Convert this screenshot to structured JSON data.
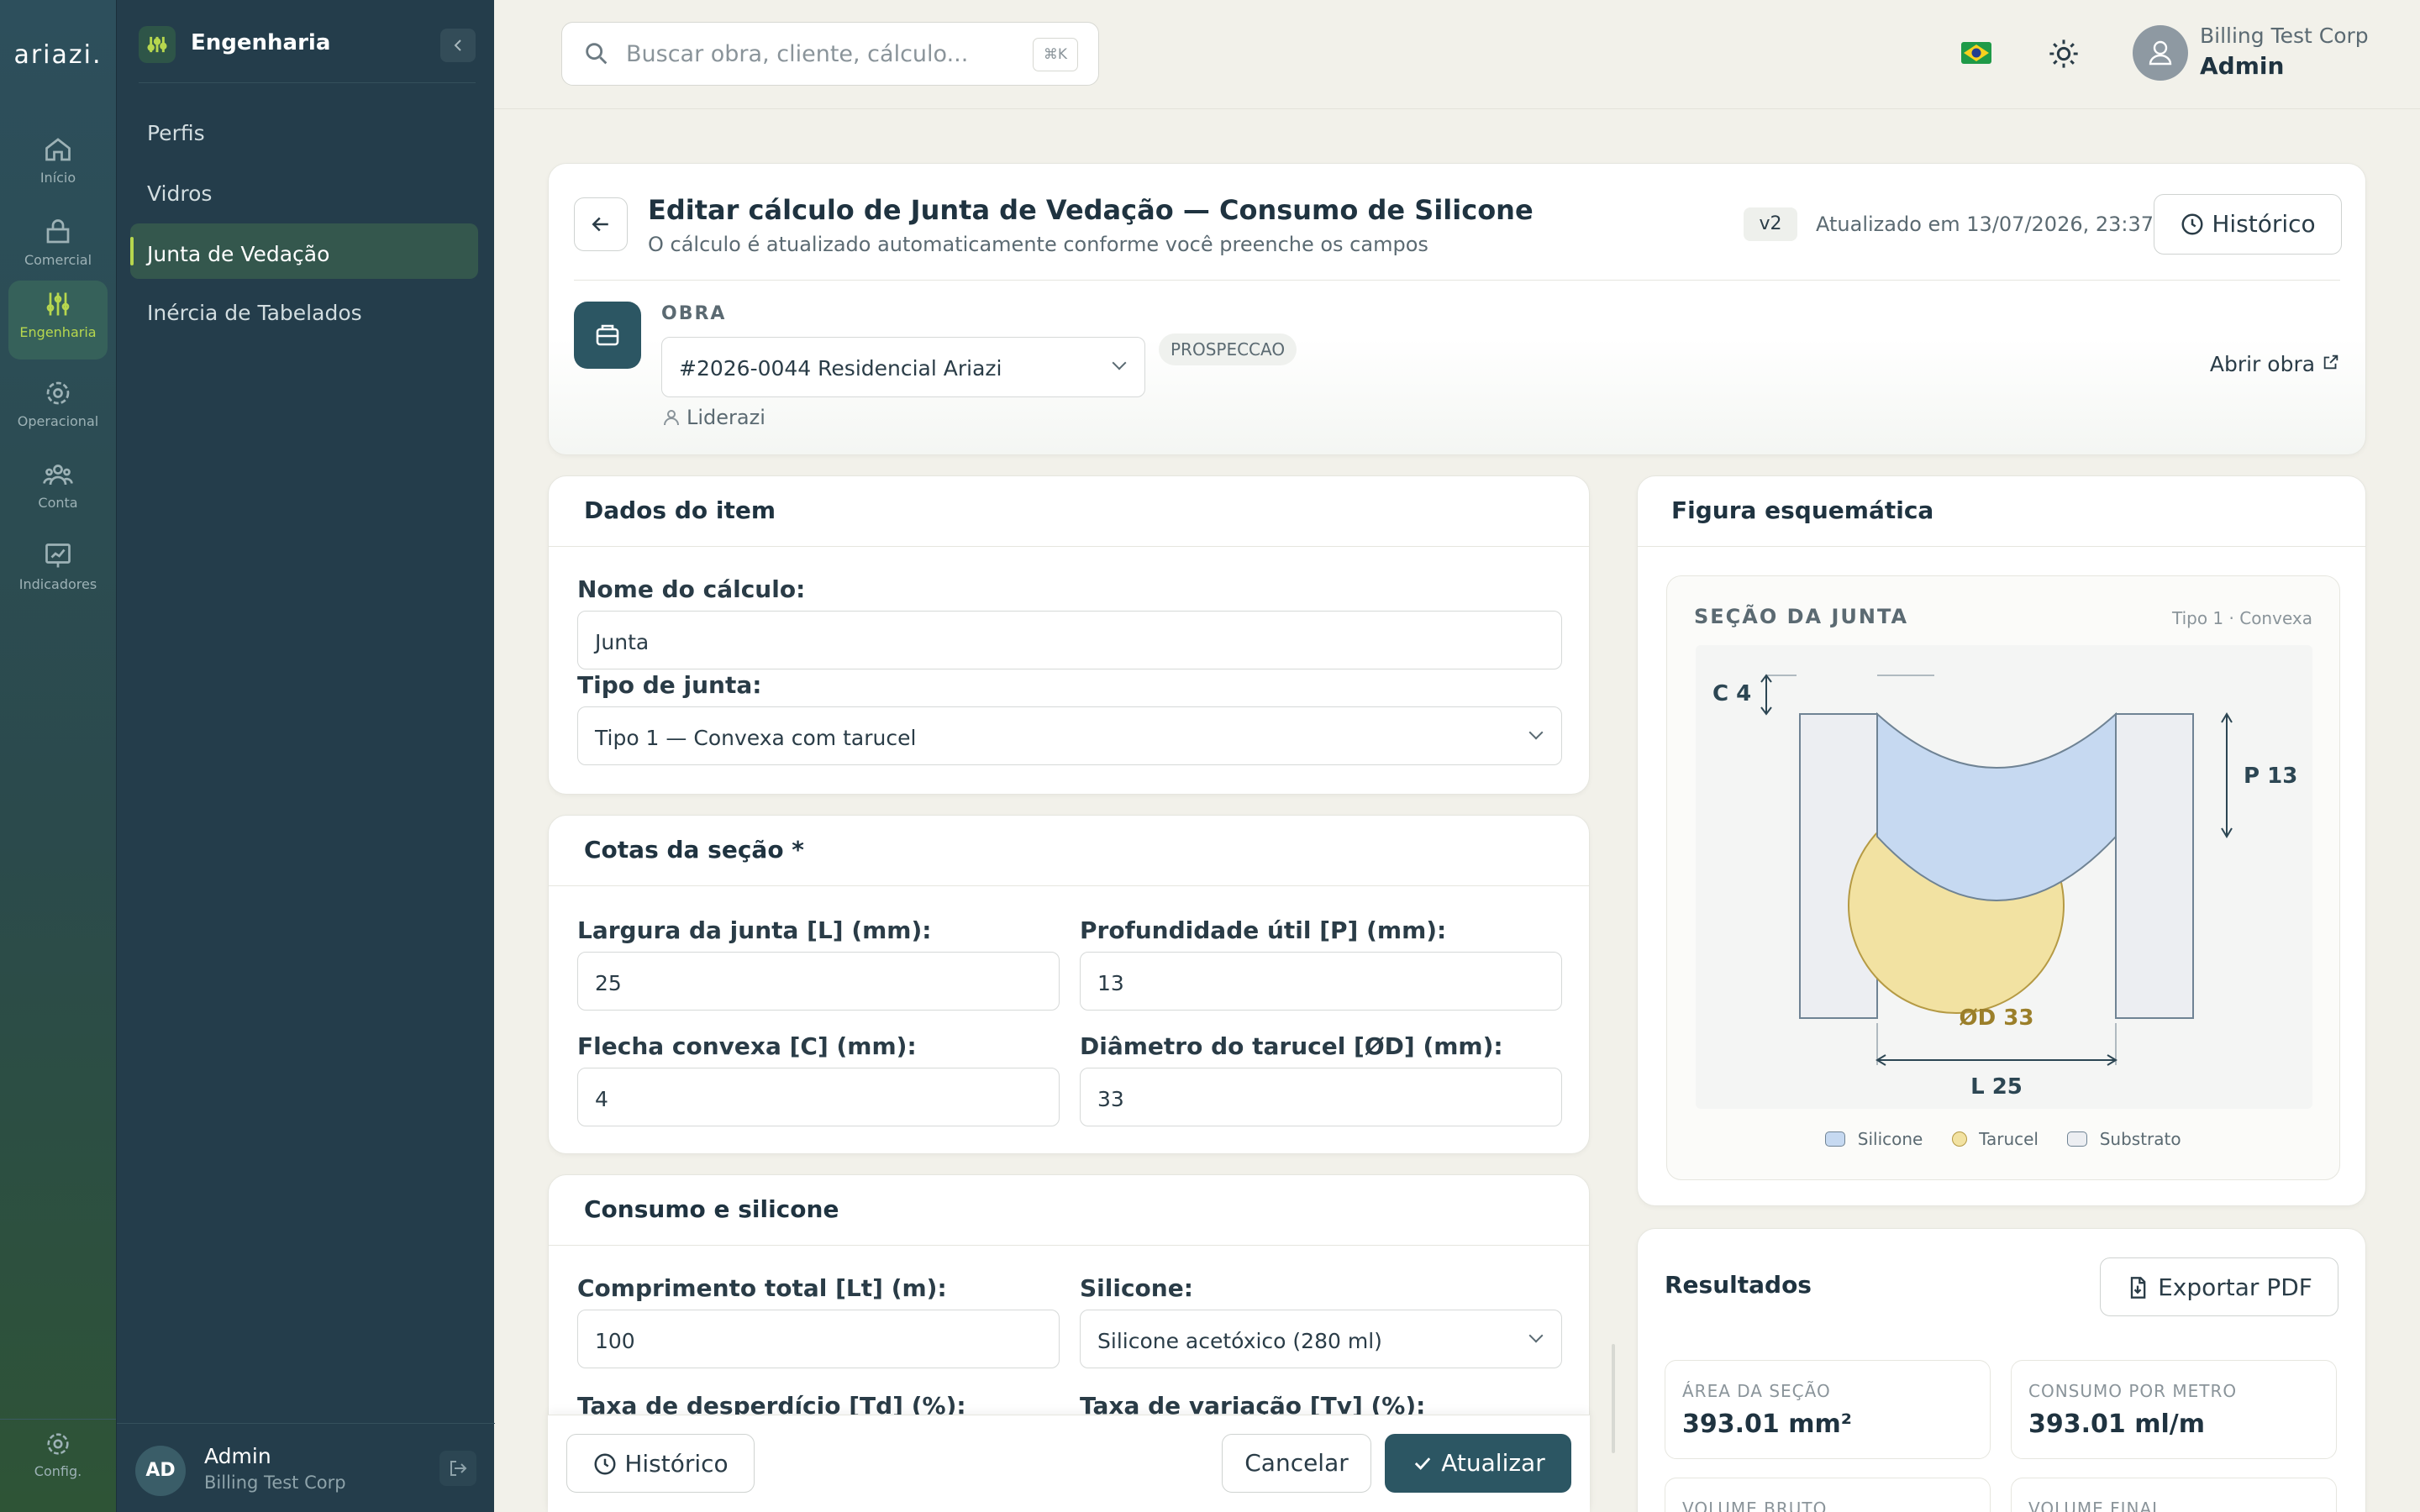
{
  "brand": "ariazi.",
  "rail": [
    {
      "label": "Início",
      "icon": "home-icon"
    },
    {
      "label": "Comercial",
      "icon": "bag-icon"
    },
    {
      "label": "Engenharia",
      "icon": "sliders-icon",
      "active": true
    },
    {
      "label": "Operacional",
      "icon": "gear-icon"
    },
    {
      "label": "Conta",
      "icon": "users-icon"
    },
    {
      "label": "Indicadores",
      "icon": "chart-icon"
    }
  ],
  "rail_config": "Config.",
  "panel": {
    "title": "Engenharia",
    "items": [
      "Perfis",
      "Vidros",
      "Junta de Vedação",
      "Inércia de Tabelados"
    ],
    "user_name": "Admin",
    "user_org": "Billing Test Corp",
    "initials": "AD"
  },
  "topbar": {
    "search_placeholder": "Buscar obra, cliente, cálculo...",
    "shortcut": "⌘K",
    "org": "Billing Test Corp",
    "user": "Admin"
  },
  "header": {
    "title": "Editar cálculo de Junta de Vedação — Consumo de Silicone",
    "subtitle": "O cálculo é atualizado automaticamente conforme você preenche os campos",
    "version": "v2",
    "updated": "Atualizado em 13/07/2026, 23:37",
    "history": "Histórico",
    "obra_label": "OBRA",
    "obra_value": "#2026-0044 Residencial Ariazi",
    "obra_status": "PROSPECCAO",
    "obra_owner": "Liderazi",
    "open_obra": "Abrir obra"
  },
  "item": {
    "title": "Dados do item",
    "name_label": "Nome do cálculo:",
    "name_value": "Junta",
    "type_label": "Tipo de junta:",
    "type_value": "Tipo 1 — Convexa com tarucel"
  },
  "cotas": {
    "title": "Cotas da seção *",
    "l_label": "Largura da junta [L] (mm):",
    "l_value": "25",
    "p_label": "Profundidade útil [P] (mm):",
    "p_value": "13",
    "c_label": "Flecha convexa [C] (mm):",
    "c_value": "4",
    "d_label": "Diâmetro do tarucel [ØD] (mm):",
    "d_value": "33"
  },
  "consumo": {
    "title": "Consumo e silicone",
    "lt_label": "Comprimento total [Lt] (m):",
    "lt_value": "100",
    "sil_label": "Silicone:",
    "sil_value": "Silicone acetóxico (280 ml)",
    "td_label": "Taxa de desperdício [Td] (%):",
    "tv_label": "Taxa de variação [Tv] (%):"
  },
  "actions": {
    "history": "Histórico",
    "cancel": "Cancelar",
    "update": "Atualizar"
  },
  "figure": {
    "title": "Figura esquemática",
    "section": "SEÇÃO DA JUNTA",
    "type": "Tipo 1 · Convexa",
    "c_dim": "C 4",
    "p_dim": "P 13",
    "d_dim": "ØD 33",
    "l_dim": "L 25",
    "legend": [
      "Silicone",
      "Tarucel",
      "Substrato"
    ],
    "colors": {
      "silicone": "#c6d9f1",
      "tarucel": "#f2e2a2",
      "substrato": "#eceef2"
    }
  },
  "results": {
    "title": "Resultados",
    "export": "Exportar PDF",
    "kpis": [
      {
        "label": "ÁREA DA SEÇÃO",
        "value": "393.01 mm²"
      },
      {
        "label": "CONSUMO POR METRO",
        "value": "393.01 ml/m"
      },
      {
        "label": "VOLUME BRUTO",
        "value": ""
      },
      {
        "label": "VOLUME FINAL",
        "value": ""
      }
    ]
  }
}
